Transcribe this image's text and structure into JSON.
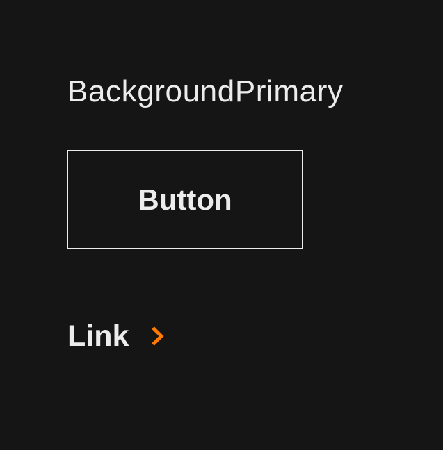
{
  "heading": {
    "text": "BackgroundPrimary"
  },
  "button": {
    "label": "Button"
  },
  "link": {
    "label": "Link",
    "icon": "chevron-right-icon"
  },
  "colors": {
    "background": "#151515",
    "text": "#ECECEC",
    "accent": "#FF7A00"
  }
}
